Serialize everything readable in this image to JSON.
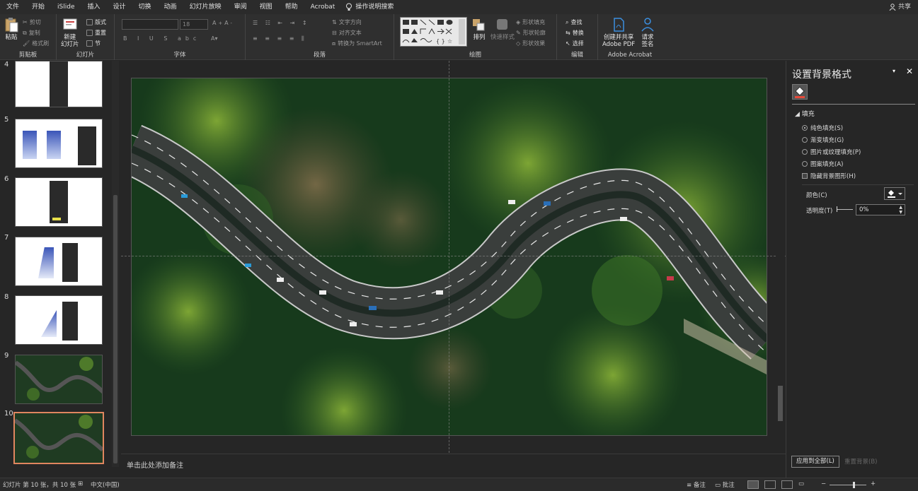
{
  "menu": {
    "items": [
      "文件",
      "开始",
      "iSlide",
      "插入",
      "设计",
      "切换",
      "动画",
      "幻灯片放映",
      "审阅",
      "视图",
      "帮助",
      "Acrobat"
    ],
    "tell_me": "操作说明搜索",
    "share": "共享"
  },
  "ribbon": {
    "clipboard": {
      "label": "剪贴板",
      "paste": "粘贴",
      "cut": "剪切",
      "copy": "复制",
      "format_painter": "格式刷"
    },
    "slides": {
      "label": "幻灯片",
      "new_slide": "新建\n幻灯片",
      "layout": "版式",
      "reset": "重置",
      "section": "节"
    },
    "font": {
      "label": "字体",
      "font_size": "18"
    },
    "paragraph": {
      "label": "段落",
      "text_direction": "文字方向",
      "align_text": "对齐文本",
      "convert_smartart": "转换为 SmartArt"
    },
    "drawing": {
      "label": "绘图",
      "arrange": "排列",
      "quick_styles": "快速样式",
      "shape_fill": "形状填充",
      "shape_outline": "形状轮廓",
      "shape_effects": "形状效果"
    },
    "editing": {
      "label": "编辑",
      "find": "查找",
      "replace": "替换",
      "select": "选择"
    },
    "acrobat": {
      "label": "Adobe Acrobat",
      "create_share": "创建并共享\nAdobe PDF",
      "request_sign": "请求\n签名"
    }
  },
  "thumbnails": [
    {
      "num": "4",
      "kind": "ui"
    },
    {
      "num": "5",
      "kind": "gradient2"
    },
    {
      "num": "6",
      "kind": "ui"
    },
    {
      "num": "7",
      "kind": "gradient-shape"
    },
    {
      "num": "8",
      "kind": "triangle"
    },
    {
      "num": "9",
      "kind": "photo"
    },
    {
      "num": "10",
      "kind": "photo",
      "selected": true
    }
  ],
  "notes_placeholder": "单击此处添加备注",
  "format_pane": {
    "title": "设置背景格式",
    "section": "填充",
    "options": [
      {
        "label": "纯色填充(S)",
        "checked": true
      },
      {
        "label": "渐变填充(G)",
        "checked": false
      },
      {
        "label": "图片或纹理填充(P)",
        "checked": false
      },
      {
        "label": "图案填充(A)",
        "checked": false
      }
    ],
    "hide_bg_graphics": "隐藏背景图形(H)",
    "color_label": "颜色(C)",
    "transparency_label": "透明度(T)",
    "transparency_value": "0%",
    "apply_all": "应用到全部(L)",
    "reset_bg": "重置背景(B)"
  },
  "status": {
    "slide_info": "幻灯片 第 10 张，共 10 张",
    "language": "中文(中国)",
    "notes": "备注",
    "comments": "批注"
  },
  "colors": {
    "accent": "#e0865f",
    "road": "#3a3e3c",
    "forest_dark": "#173a1c",
    "forest_light": "#6e9a2c"
  }
}
